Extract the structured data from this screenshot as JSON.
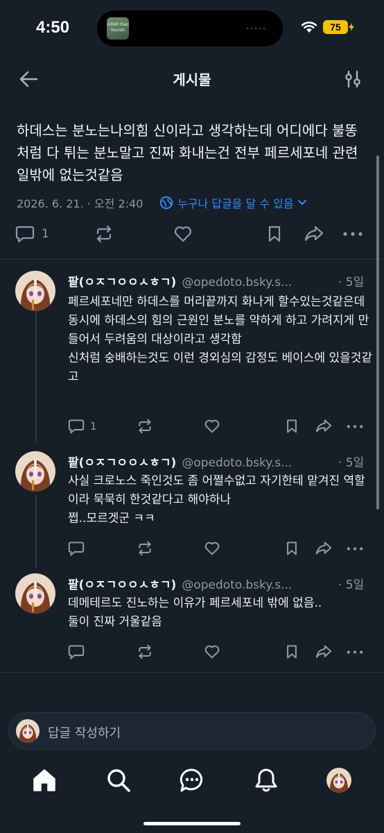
{
  "status": {
    "time": "4:50",
    "battery": "75",
    "island_label": "ASMR Rain Sounds"
  },
  "header": {
    "title": "게시물"
  },
  "post": {
    "text": "하데스는 분노는나의힘 신이라고 생각하는데 어디에다 불똥처럼 다 튀는 분노말고 진짜 화내는건 전부 페르세포네 관련 일밖에 없는것같음",
    "meta": "2026. 6. 21. · 오전 2:40",
    "reply_permission": "누구나 답글을 달 수 있음",
    "reply_count": "1"
  },
  "replies": [
    {
      "name": "팥(ㅇㅈㄱㅇㅇㅅㅎㄱ)",
      "handle": "@opedoto.bsky.s...",
      "time": "· 5일",
      "text": "페르세포네만 하데스를 머리끝까지 화나게 할수있는것같은데\n동시에 하데스의 힘의 근원인 분노를 약하게 하고 가려지게 만들어서 두려움의 대상이라고 생각함\n신처럼 숭배하는것도 이런 경외심의 감정도 베이스에 있을것같고",
      "reply_count": "1"
    },
    {
      "name": "팥(ㅇㅈㄱㅇㅇㅅㅎㄱ)",
      "handle": "@opedoto.bsky.s...",
      "time": "· 5일",
      "text": "사실 크로노스 죽인것도 좀 어쩔수없고 자기한테 맡겨진 역할이라 묵묵히 한것같다고 해야하나\n쩝..모르겟군 ㅋㅋ",
      "reply_count": ""
    },
    {
      "name": "팥(ㅇㅈㄱㅇㅇㅅㅎㄱ)",
      "handle": "@opedoto.bsky.s...",
      "time": "· 5일",
      "text": "데메테르도 진노하는 이유가 페르세포네 밖에 없음..\n둘이 진짜 거울같음",
      "reply_count": ""
    }
  ],
  "composer": {
    "placeholder": "답글 작성하기"
  },
  "colors": {
    "background": "#161e27",
    "accent": "#2f8cff",
    "muted": "#8e9aa8",
    "battery": "#f5c400"
  }
}
